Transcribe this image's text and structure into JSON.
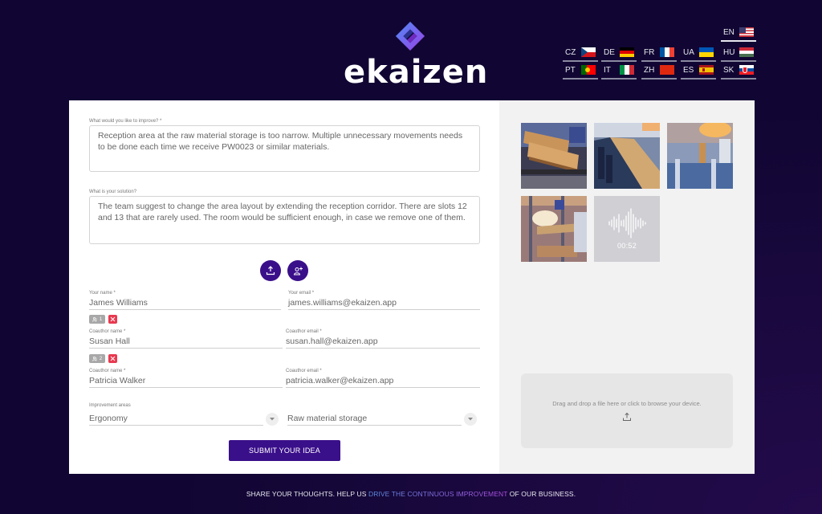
{
  "brand": {
    "name": "ekaizen",
    "colors": {
      "primary": "#3a0f8a",
      "background": "#110633",
      "danger": "#e8394f"
    }
  },
  "languages": [
    {
      "code": "EN",
      "flag": "us-flag",
      "active": true
    },
    {
      "code": "CZ",
      "flag": "cz-flag"
    },
    {
      "code": "DE",
      "flag": "de-flag"
    },
    {
      "code": "FR",
      "flag": "fr-flag"
    },
    {
      "code": "UA",
      "flag": "ua-flag"
    },
    {
      "code": "HU",
      "flag": "hu-flag"
    },
    {
      "code": "PT",
      "flag": "pt-flag"
    },
    {
      "code": "IT",
      "flag": "it-flag"
    },
    {
      "code": "ZH",
      "flag": "cn-flag"
    },
    {
      "code": "ES",
      "flag": "es-flag"
    },
    {
      "code": "SK",
      "flag": "sk-flag"
    }
  ],
  "form": {
    "improve": {
      "label": "What would you like to improve? *",
      "value": "Reception area at the raw material storage is too narrow. Multiple unnecessary movements needs to be done each time we receive PW0023 or similar materials."
    },
    "solution": {
      "label": "What is your solution?",
      "value": "The team suggest to change the area layout by extending the reception corridor. There are slots 12 and 13 that are rarely used. The room would be sufficient enough, in case we remove one of them."
    },
    "actions": {
      "upload_icon": "upload-icon",
      "add_coauthor_icon": "add-coauthor-icon"
    },
    "author": {
      "name_label": "Your name *",
      "name_value": "James Williams",
      "email_label": "Your email *",
      "email_value": "james.williams@ekaizen.app"
    },
    "coauthors": [
      {
        "index": "1",
        "name_label": "Coauthor name *",
        "name_value": "Susan Hall",
        "email_label": "Coauthor email *",
        "email_value": "susan.hall@ekaizen.app"
      },
      {
        "index": "2",
        "name_label": "Coauthor name *",
        "name_value": "Patricia Walker",
        "email_label": "Coauthor email *",
        "email_value": "patricia.walker@ekaizen.app"
      }
    ],
    "areas": {
      "label": "Improvement areas",
      "first_value": "Ergonomy",
      "second_value": "Raw material storage"
    },
    "submit_label": "SUBMIT YOUR IDEA"
  },
  "attachments": {
    "images": [
      "conveyor-wood-planks-photo",
      "wood-panel-production-line-photo",
      "factory-conveyor-photo",
      "warehouse-lumber-photo"
    ],
    "audio": {
      "duration": "00:52"
    },
    "dropzone_text": "Drag and drop a file here or click to browse your device."
  },
  "footer": {
    "before": "SHARE YOUR THOUGHTS. HELP US ",
    "highlight": "DRIVE THE CONTINUOUS IMPROVEMENT",
    "after": " OF OUR BUSINESS."
  }
}
